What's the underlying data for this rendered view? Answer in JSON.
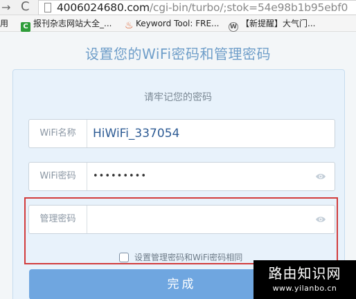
{
  "browser": {
    "url_main": "4006024680.com",
    "url_rest": "/cgi-bin/turbo/;stok=54e98b1b95ebf0",
    "bookmarks": [
      {
        "label": "应用"
      },
      {
        "label": "报刊杂志网站大全_..."
      },
      {
        "label": "Keyword Tool: FRE..."
      },
      {
        "label": "【新提醒】大气门..."
      }
    ]
  },
  "page": {
    "title": "设置您的WiFi密码和管理密码",
    "subtitle": "请牢记您的密码"
  },
  "form": {
    "wifi_name_label": "WiFi名称",
    "wifi_name_value": "HiWiFi_337054",
    "wifi_password_label": "WiFi密码",
    "wifi_password_value": "•••••••••",
    "admin_password_label": "管理密码",
    "admin_password_value": "",
    "same_password_label": "设置管理密码和WiFi密码相同",
    "same_password_checked": false,
    "submit_label": "完成"
  },
  "watermark": {
    "main": "路由知识网",
    "sub": "www.yilanbo.cn"
  },
  "colors": {
    "title_blue": "#6f9ec9",
    "button_blue": "#6fa6e0",
    "highlight_red": "#d23b3b"
  }
}
